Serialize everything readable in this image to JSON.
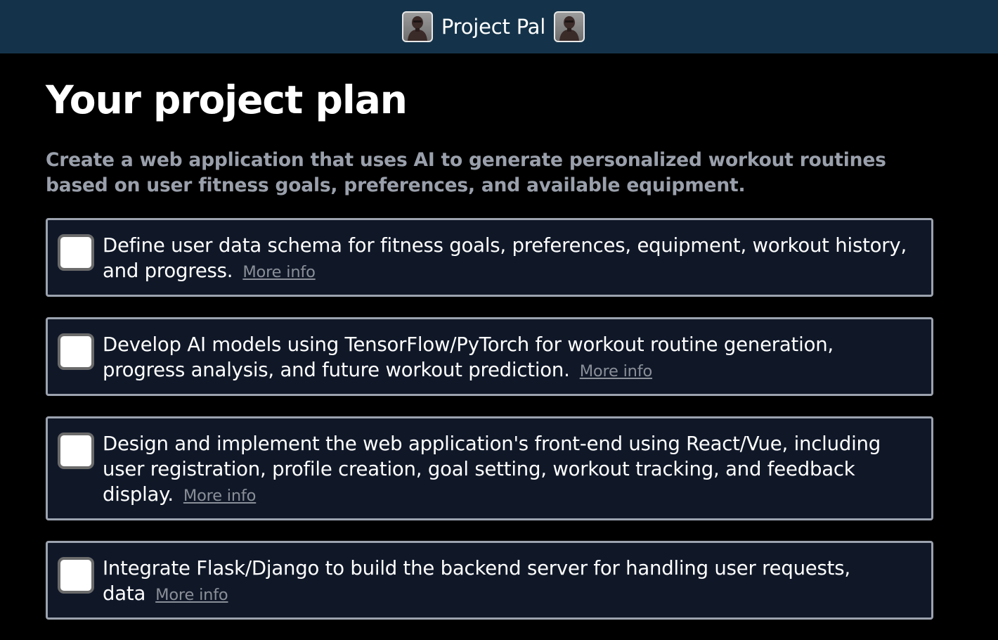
{
  "header": {
    "title": "Project Pal",
    "colors": {
      "bar": "#14334a"
    },
    "left_icon": "robot-avatar-icon",
    "right_icon": "robot-avatar-icon"
  },
  "main": {
    "title": "Your project plan",
    "description": "Create a web application that uses AI to generate personalized workout routines based on user fitness goals, preferences, and available equipment.",
    "tasks": [
      {
        "text": "Define user data schema for fitness goals, preferences, equipment, workout history, and progress.",
        "link": "More info",
        "checked": false
      },
      {
        "text": "Develop AI models using TensorFlow/PyTorch for workout routine generation, progress analysis, and future workout prediction.",
        "link": "More info",
        "checked": false
      },
      {
        "text": "Design and implement the web application's front-end using React/Vue, including user registration, profile creation, goal setting, workout tracking, and feedback display.",
        "link": "More info",
        "checked": false
      },
      {
        "text": "Integrate Flask/Django to build the backend server for handling user requests, data",
        "link": "More info",
        "checked": false
      }
    ]
  },
  "colors": {
    "background": "#000000",
    "card_background": "#101828",
    "card_border": "#9ca3af",
    "description_text": "#9aa0ab",
    "link_text": "#8a8f98"
  }
}
